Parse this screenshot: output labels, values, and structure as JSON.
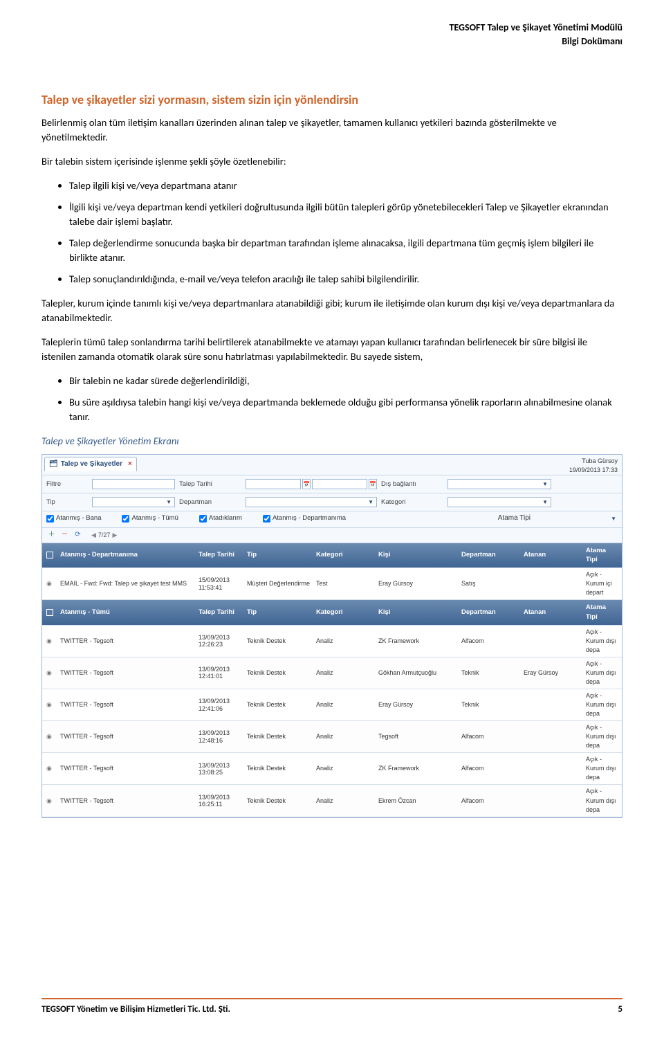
{
  "header": {
    "line1": "TEGSOFT Talep ve Şikayet Yönetimi Modülü",
    "line2": "Bilgi Dokümanı"
  },
  "section_title": "Talep ve şikayetler sizi yormasın, sistem sizin için yönlendirsin",
  "p1": "Belirlenmiş olan tüm iletişim kanalları üzerinden alınan talep ve şikayetler, tamamen kullanıcı yetkileri bazında gösterilmekte ve yönetilmektedir.",
  "p2": "Bir talebin sistem içerisinde işlenme şekli şöyle özetlenebilir:",
  "bullets_a": [
    "Talep ilgili kişi ve/veya departmana atanır",
    "İlgili kişi ve/veya departman kendi yetkileri doğrultusunda ilgili bütün talepleri görüp yönetebilecekleri Talep ve Şikayetler ekranından talebe dair işlemi başlatır.",
    "Talep değerlendirme sonucunda başka bir departman tarafından işleme alınacaksa, ilgili departmana tüm geçmiş işlem bilgileri ile birlikte atanır.",
    "Talep sonuçlandırıldığında, e-mail ve/veya telefon aracılığı ile talep sahibi bilgilendirilir."
  ],
  "p3": "Talepler, kurum içinde tanımlı kişi ve/veya departmanlara atanabildiği gibi; kurum ile iletişimde olan kurum dışı kişi ve/veya departmanlara da atanabilmektedir.",
  "p4": "Taleplerin tümü talep sonlandırma tarihi belirtilerek atanabilmekte ve atamayı yapan kullanıcı tarafından belirlenecek bir süre bilgisi ile istenilen zamanda otomatik olarak süre sonu hatırlatması yapılabilmektedir. Bu sayede sistem,",
  "bullets_b": [
    "Bir talebin ne kadar sürede değerlendirildiği,",
    "Bu süre aşıldıysa talebin hangi kişi ve/veya departmanda beklemede olduğu gibi performansa yönelik raporların alınabilmesine olanak tanır."
  ],
  "caption": "Talep ve Şikayetler Yönetim Ekranı",
  "app": {
    "tab_title": "Talep ve Şikayetler",
    "user_name": "Tuba Gürsoy",
    "user_time": "19/09/2013 17:33",
    "labels": {
      "filtre": "Filtre",
      "talep_tarihi": "Talep Tarihi",
      "dis_baglanti": "Dış bağlantı",
      "tip": "Tip",
      "departman": "Departman",
      "kategori": "Kategori",
      "atama_tipi": "Atama Tipi"
    },
    "checks": {
      "c1": "Atanmış - Bana",
      "c2": "Atanmış - Tümü",
      "c3": "Atadıklarım",
      "c4": "Atanmış - Departmanıma"
    },
    "pager": "7/27",
    "columns": [
      "",
      "",
      "Talep Tarihi",
      "Tip",
      "Kategori",
      "Kişi",
      "Departman",
      "Atanan",
      "Atama Tipi"
    ],
    "section1_title": "Atanmış - Departmanıma",
    "section2_title": "Atanmış - Tümü",
    "rows1": [
      {
        "subj": "EMAIL - Fwd: Fwd: Talep ve şikayet test MMS",
        "date": "15/09/2013 11:53:41",
        "tip": "Müşteri Değerlendirme",
        "kat": "Test",
        "kisi": "Eray Gürsoy",
        "dep": "Satış",
        "atanan": "",
        "atip": "Açık - Kurum içi depart"
      }
    ],
    "rows2": [
      {
        "subj": "TWITTER - Tegsoft",
        "date": "13/09/2013 12:26:23",
        "tip": "Teknik Destek",
        "kat": "Analiz",
        "kisi": "ZK Framework",
        "dep": "Alfacom",
        "atanan": "",
        "atip": "Açık - Kurum dışı depa"
      },
      {
        "subj": "TWITTER - Tegsoft",
        "date": "13/09/2013 12:41:01",
        "tip": "Teknik Destek",
        "kat": "Analiz",
        "kisi": "Gökhan Armutçuoğlu",
        "dep": "Teknik",
        "atanan": "Eray Gürsoy",
        "atip": "Açık - Kurum dışı depa"
      },
      {
        "subj": "TWITTER - Tegsoft",
        "date": "13/09/2013 12:41:06",
        "tip": "Teknik Destek",
        "kat": "Analiz",
        "kisi": "Eray Gürsoy",
        "dep": "Teknik",
        "atanan": "",
        "atip": "Açık - Kurum dışı depa"
      },
      {
        "subj": "TWITTER - Tegsoft",
        "date": "13/09/2013 12:48:16",
        "tip": "Teknik Destek",
        "kat": "Analiz",
        "kisi": "Tegsoft",
        "dep": "Alfacom",
        "atanan": "",
        "atip": "Açık - Kurum dışı depa"
      },
      {
        "subj": "TWITTER - Tegsoft",
        "date": "13/09/2013 13:08:25",
        "tip": "Teknik Destek",
        "kat": "Analiz",
        "kisi": "ZK Framework",
        "dep": "Alfacom",
        "atanan": "",
        "atip": "Açık - Kurum dışı depa"
      },
      {
        "subj": "TWITTER - Tegsoft",
        "date": "13/09/2013 16:25:11",
        "tip": "Teknik Destek",
        "kat": "Analiz",
        "kisi": "Ekrem Özcan",
        "dep": "Alfacom",
        "atanan": "",
        "atip": "Açık - Kurum dışı depa"
      }
    ]
  },
  "footer": {
    "left": "TEGSOFT Yönetim ve Bilişim Hizmetleri Tic. Ltd. Şti.",
    "right": "5"
  }
}
